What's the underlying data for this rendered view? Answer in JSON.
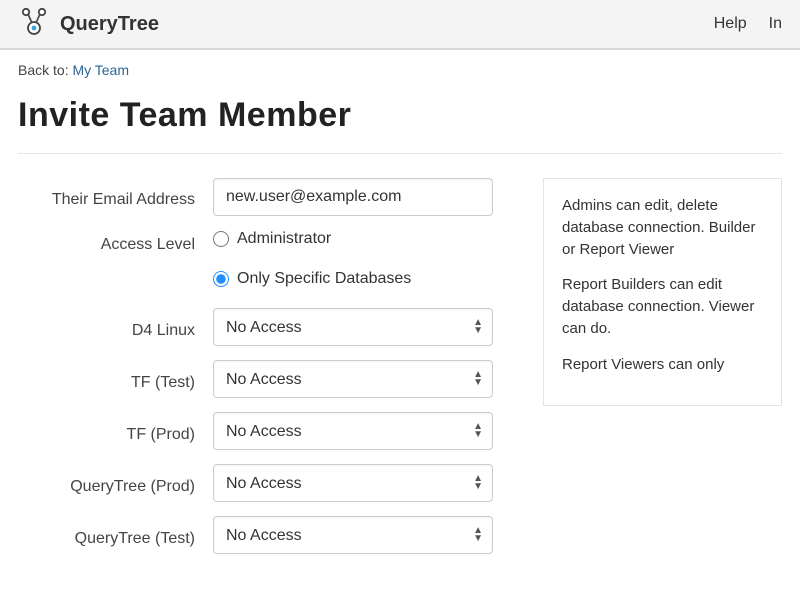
{
  "brand": {
    "name": "QueryTree"
  },
  "topnav": {
    "help": "Help",
    "second": "In"
  },
  "breadcrumb": {
    "prefix": "Back to: ",
    "link": "My Team"
  },
  "page_title": "Invite Team Member",
  "form": {
    "email_label": "Their Email Address",
    "email_value": "new.user@example.com",
    "access_label": "Access Level",
    "radio_admin": "Administrator",
    "radio_specific": "Only Specific Databases",
    "databases": [
      {
        "label": "D4 Linux",
        "value": "No Access"
      },
      {
        "label": "TF (Test)",
        "value": "No Access"
      },
      {
        "label": "TF (Prod)",
        "value": "No Access"
      },
      {
        "label": "QueryTree (Prod)",
        "value": "No Access"
      },
      {
        "label": "QueryTree (Test)",
        "value": "No Access"
      }
    ]
  },
  "help_panel": {
    "p1": "Admins can edit, delete database connection. Builder or Report Viewer",
    "p2": "Report Builders can edit database connection. Viewer can do.",
    "p3": "Report Viewers can only"
  }
}
